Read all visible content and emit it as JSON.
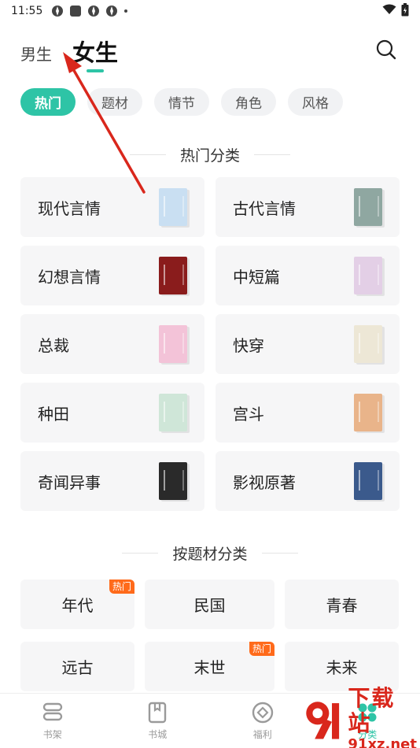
{
  "status_bar": {
    "time": "11:55"
  },
  "top_tabs": {
    "male": "男生",
    "female": "女生"
  },
  "sub_tabs": [
    "热门",
    "题材",
    "情节",
    "角色",
    "风格"
  ],
  "hot_section": {
    "title": "热门分类",
    "items": [
      {
        "label": "现代言情",
        "cover_color": "#c9dff2"
      },
      {
        "label": "古代言情",
        "cover_color": "#8fa7a1"
      },
      {
        "label": "幻想言情",
        "cover_color": "#8a1c1c"
      },
      {
        "label": "中短篇",
        "cover_color": "#e3cfe6"
      },
      {
        "label": "总裁",
        "cover_color": "#f3c3d8"
      },
      {
        "label": "快穿",
        "cover_color": "#ede7d6"
      },
      {
        "label": "种田",
        "cover_color": "#cfe6d8"
      },
      {
        "label": "宫斗",
        "cover_color": "#e9b48a"
      },
      {
        "label": "奇闻异事",
        "cover_color": "#2a2a2a"
      },
      {
        "label": "影视原著",
        "cover_color": "#3b5a8c"
      }
    ]
  },
  "theme_section": {
    "title": "按题材分类",
    "items": [
      {
        "label": "年代",
        "badge": "热门"
      },
      {
        "label": "民国",
        "badge": ""
      },
      {
        "label": "青春",
        "badge": ""
      },
      {
        "label": "远古",
        "badge": ""
      },
      {
        "label": "末世",
        "badge": "热门"
      },
      {
        "label": "未来",
        "badge": ""
      }
    ]
  },
  "bottom_nav": [
    {
      "label": "书架",
      "icon": "bookshelf-icon"
    },
    {
      "label": "书城",
      "icon": "bookstore-icon"
    },
    {
      "label": "福利",
      "icon": "welfare-icon"
    },
    {
      "label": "分类",
      "icon": "category-icon"
    }
  ],
  "watermark": {
    "big": "下载站",
    "small": "91xz.net"
  },
  "colors": {
    "accent": "#2ec4a6",
    "hot_badge": "#ff6a1a",
    "annotation_arrow": "#d9271c"
  }
}
